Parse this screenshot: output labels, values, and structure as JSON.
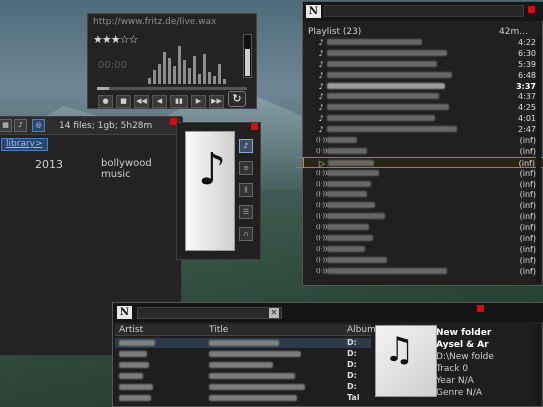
{
  "mini_player": {
    "url": "http://www.fritz.de/live.wax",
    "stars": "★★★☆☆",
    "time": "00:00",
    "volume_fraction": 0.65,
    "seek_fraction": 0.08,
    "controls": [
      "●",
      "■",
      "◀◀",
      "◀",
      "▮▮",
      "▶",
      "▶▶"
    ],
    "repeat_glyph": "↻"
  },
  "library": {
    "info": "14 files; 1gb; 5h28m",
    "breadcrumb": "library>",
    "year": "2013",
    "genre": "bollywood music"
  },
  "playlist": {
    "caption": "Playlist (23)",
    "total": "42m...",
    "rows": [
      {
        "dur": "4:22",
        "type": "note"
      },
      {
        "dur": "6:30",
        "type": "note"
      },
      {
        "dur": "5:39",
        "type": "note"
      },
      {
        "dur": "6:48",
        "type": "note"
      },
      {
        "dur": "3:37",
        "type": "note",
        "bold": true
      },
      {
        "dur": "4:37",
        "type": "note"
      },
      {
        "dur": "4:25",
        "type": "note"
      },
      {
        "dur": "4:01",
        "type": "note"
      },
      {
        "dur": "2:47",
        "type": "note"
      },
      {
        "dur": "(inf)",
        "type": "radio"
      },
      {
        "dur": "(inf)",
        "type": "radio"
      },
      {
        "dur": "(inf)",
        "type": "play",
        "current": true
      },
      {
        "dur": "(inf)",
        "type": "radio"
      },
      {
        "dur": "(inf)",
        "type": "radio"
      },
      {
        "dur": "(inf)",
        "type": "radio"
      },
      {
        "dur": "(inf)",
        "type": "radio"
      },
      {
        "dur": "(inf)",
        "type": "radio"
      },
      {
        "dur": "(inf)",
        "type": "radio"
      },
      {
        "dur": "(inf)",
        "type": "radio"
      },
      {
        "dur": "(inf)",
        "type": "radio"
      },
      {
        "dur": "(inf)",
        "type": "radio"
      },
      {
        "dur": "(inf)",
        "type": "radio"
      }
    ]
  },
  "browser": {
    "columns": [
      "Artist",
      "Title",
      "Album"
    ],
    "rows": [
      {
        "tail": "D:"
      },
      {
        "tail": "D:"
      },
      {
        "tail": "D:"
      },
      {
        "tail": "D:"
      },
      {
        "tail": "D:"
      },
      {
        "tail": "Tal"
      }
    ],
    "meta": {
      "folder": "New folder",
      "artist": "Aysel & Ar",
      "path": "D:\\New folde",
      "track": "Track 0",
      "year": "Year N/A",
      "genre": "Genre N/A"
    }
  },
  "logo": "N"
}
